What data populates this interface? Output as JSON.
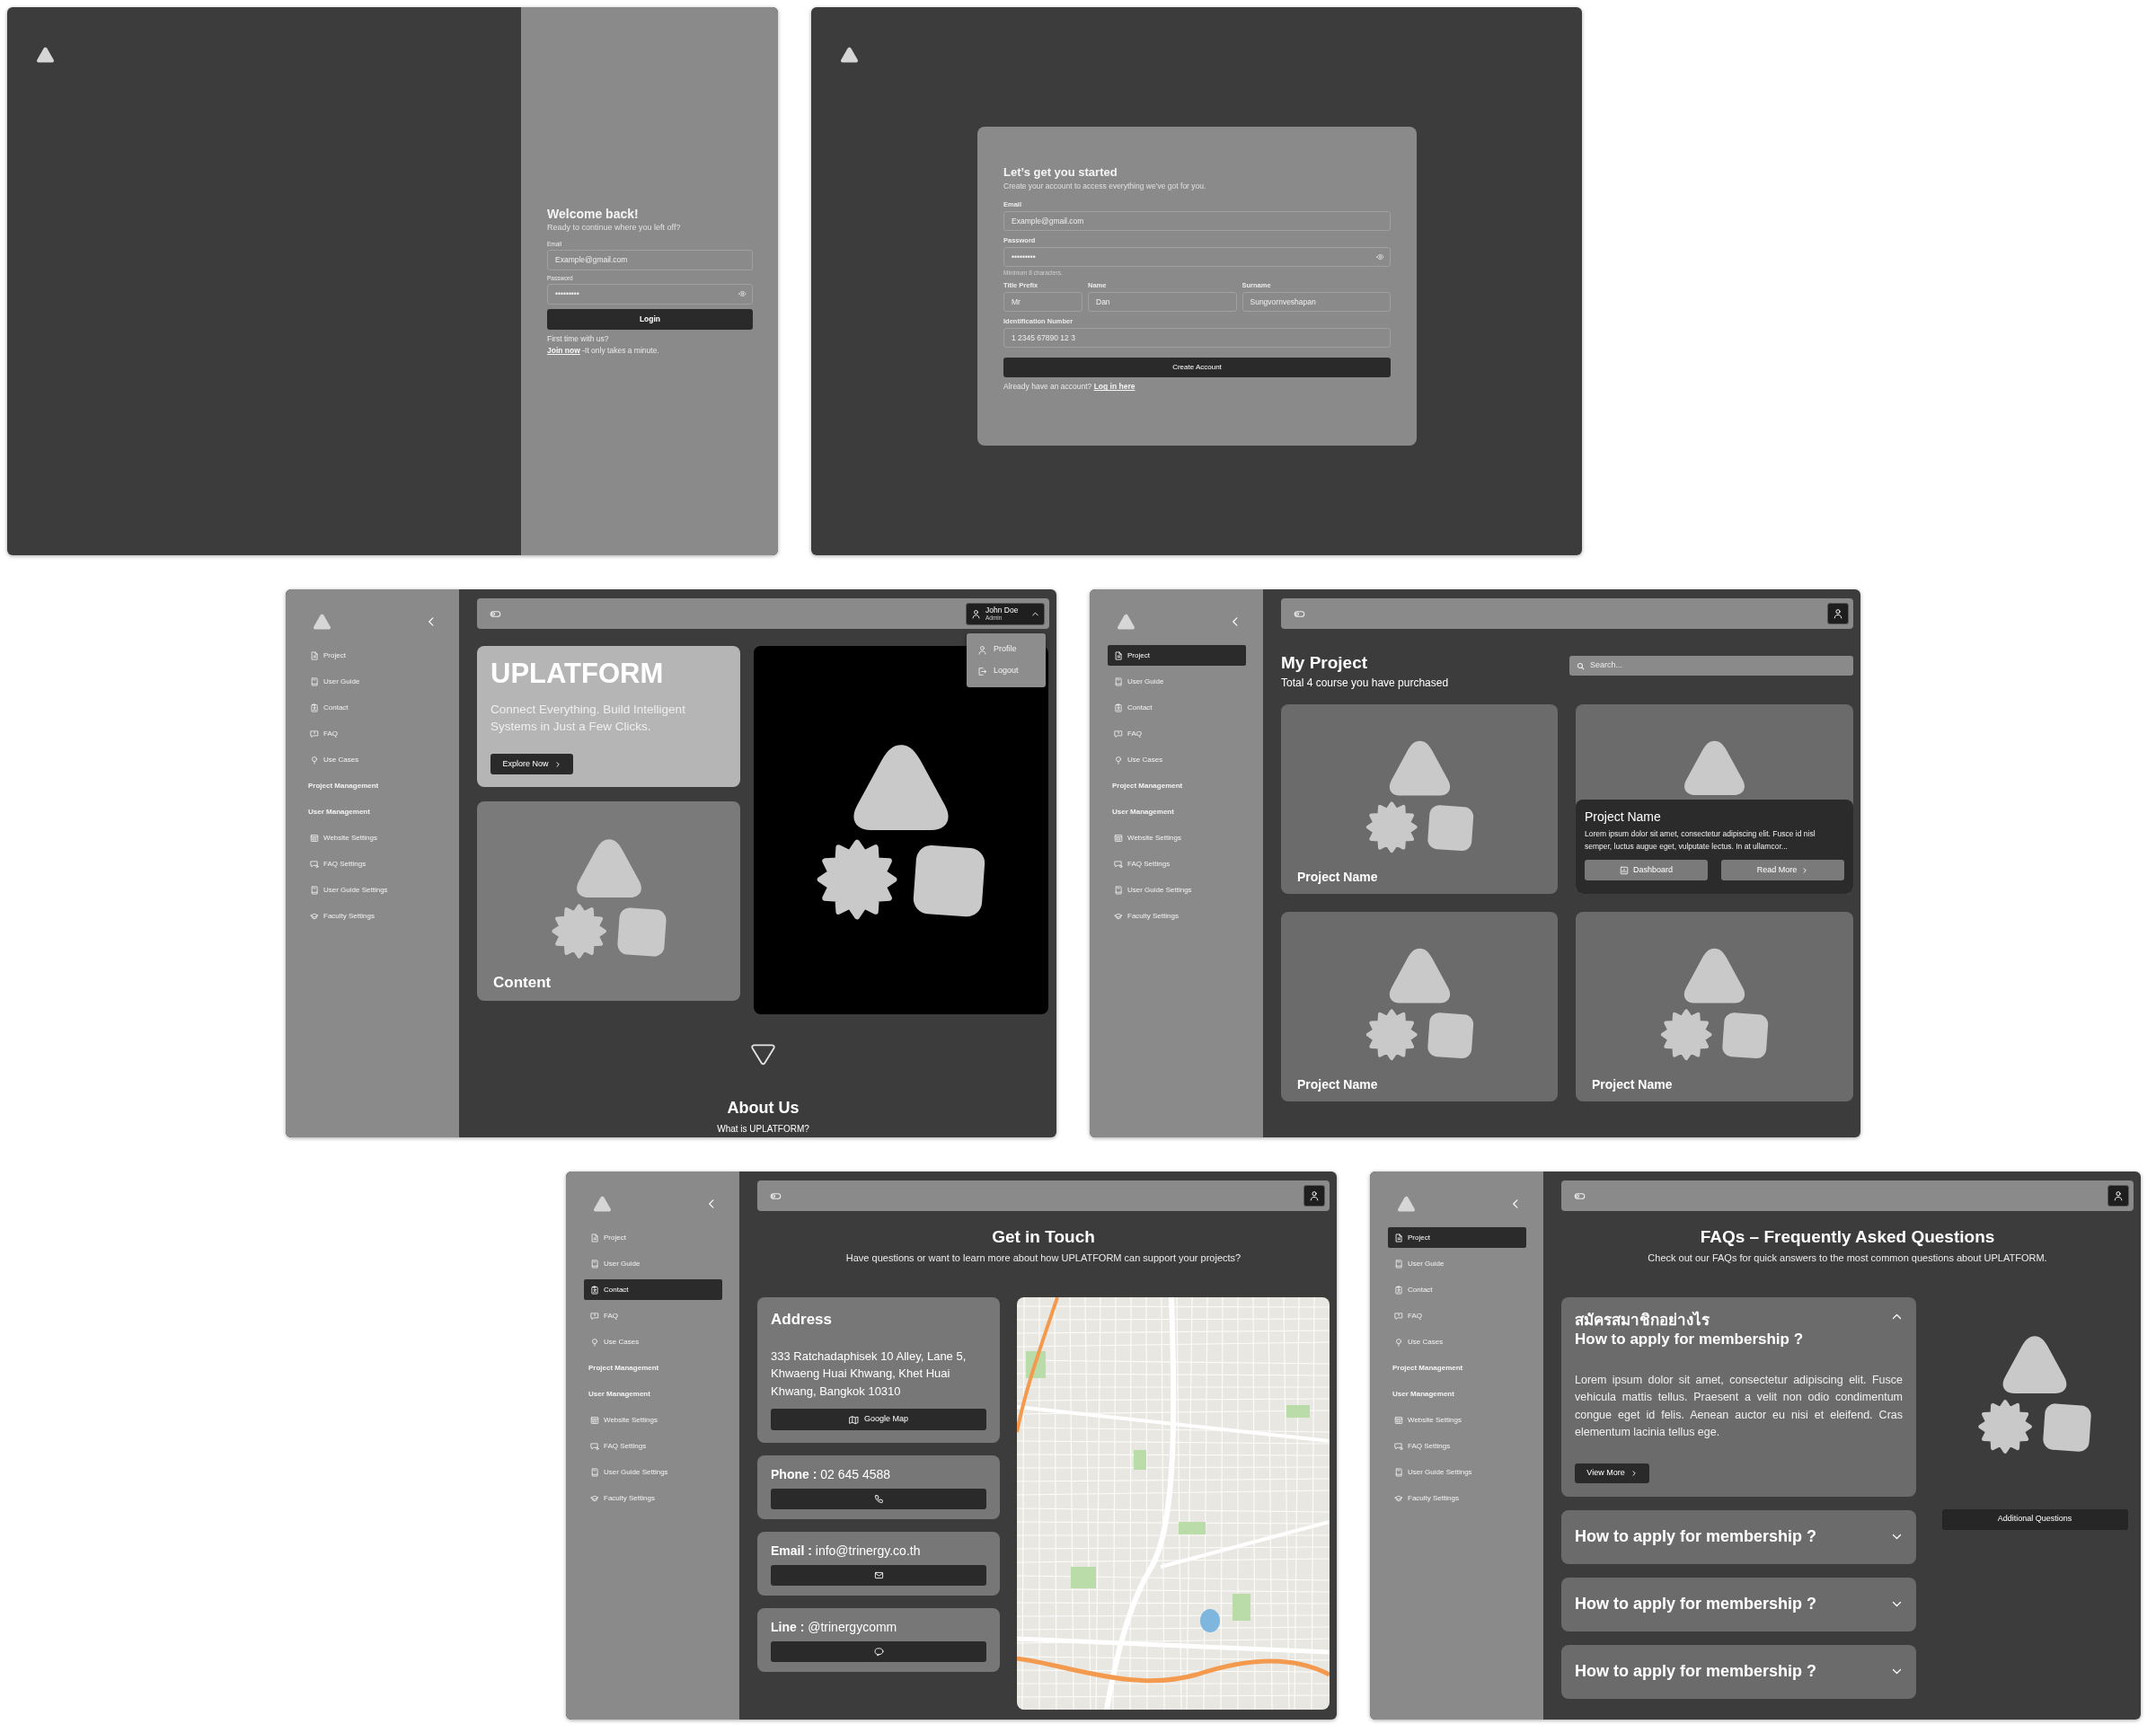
{
  "login": {
    "title": "Welcome back!",
    "subtitle": "Ready to continue where you left off?",
    "fields": [
      {
        "label": "Email",
        "value": "Example@gmail.com",
        "kind": "text"
      },
      {
        "label": "Password",
        "value": "•••••••••",
        "kind": "password"
      }
    ],
    "button": "Login",
    "note": "First time with us?",
    "footer": {
      "link": "Join now",
      "text": " -It only takes a minute."
    }
  },
  "signup": {
    "title": "Let’s get you started",
    "subtitle": "Create your account to access everything we’ve got for you.",
    "rows": [
      {
        "fields": [
          {
            "label": "Email",
            "value": "Example@gmail.com",
            "kind": "text"
          }
        ]
      },
      {
        "fields": [
          {
            "label": "Password",
            "value": "•••••••••",
            "kind": "password",
            "hint": "Minimum 8 characters."
          }
        ]
      },
      {
        "fields": [
          {
            "label": "Title Prefix",
            "value": "Mr",
            "kind": "text"
          },
          {
            "label": "Name",
            "value": "Dan",
            "kind": "text"
          },
          {
            "label": "Surname",
            "value": "Sungvornveshapan",
            "kind": "text"
          }
        ]
      },
      {
        "fields": [
          {
            "label": "Identification Number",
            "value": "1 2345 67890 12 3",
            "kind": "text"
          }
        ]
      }
    ],
    "button": "Create Account",
    "footer": {
      "text": "Already have an account? ",
      "link": "Log in here"
    }
  },
  "home": {
    "sidebar": {
      "items": [
        {
          "label": "Project",
          "kind": "link",
          "selected": false
        },
        {
          "label": "User Guide",
          "kind": "link",
          "selected": false
        },
        {
          "label": "Contact",
          "kind": "link",
          "selected": false
        },
        {
          "label": "FAQ",
          "kind": "link",
          "selected": false
        },
        {
          "label": "Use Cases",
          "kind": "link",
          "selected": false
        },
        {
          "label": "Project Management",
          "kind": "heading",
          "selected": false
        },
        {
          "label": "User Management",
          "kind": "heading",
          "selected": false
        },
        {
          "label": "Website Settings",
          "kind": "link",
          "selected": false
        },
        {
          "label": "FAQ Settings",
          "kind": "link",
          "selected": false
        },
        {
          "label": "User Guide Settings",
          "kind": "link",
          "selected": false
        },
        {
          "label": "Faculty Settings",
          "kind": "link",
          "selected": false
        }
      ]
    },
    "topbar": {
      "user": {
        "name": "John Doe",
        "role": "Admin",
        "expanded": true,
        "menu": [
          "Profile",
          "Logout"
        ]
      }
    },
    "hero": {
      "title": "UPLATFORM",
      "text": "Connect Everything. Build Intelligent Systems in Just a Few Clicks.",
      "button": "Explore Now"
    },
    "content_card": {
      "title": "Content"
    },
    "about": {
      "title": "About Us",
      "subtitle": "What is UPLATFORM?"
    }
  },
  "projects": {
    "sidebar": {
      "items": [
        {
          "label": "Project",
          "kind": "link",
          "selected": true
        },
        {
          "label": "User Guide",
          "kind": "link",
          "selected": false
        },
        {
          "label": "Contact",
          "kind": "link",
          "selected": false
        },
        {
          "label": "FAQ",
          "kind": "link",
          "selected": false
        },
        {
          "label": "Use Cases",
          "kind": "link",
          "selected": false
        },
        {
          "label": "Project Management",
          "kind": "heading",
          "selected": false
        },
        {
          "label": "User Management",
          "kind": "heading",
          "selected": false
        },
        {
          "label": "Website Settings",
          "kind": "link",
          "selected": false
        },
        {
          "label": "FAQ Settings",
          "kind": "link",
          "selected": false
        },
        {
          "label": "User Guide Settings",
          "kind": "link",
          "selected": false
        },
        {
          "label": "Faculty Settings",
          "kind": "link",
          "selected": false
        }
      ]
    },
    "title": "My Project",
    "subtitle": "Total 4 course you have purchased",
    "search": {
      "placeholder": "Search..."
    },
    "cards": [
      {
        "title": "Project Name",
        "expanded": false
      },
      {
        "title": "Project Name",
        "expanded": true,
        "description": "Lorem ipsum dolor sit amet, consectetur adipiscing elit. Fusce id nisl semper, luctus augue eget, vulputate lectus. In at ullamcor...",
        "buttons": [
          "Dashboard",
          "Read More"
        ]
      },
      {
        "title": "Project Name",
        "expanded": false
      },
      {
        "title": "Project Name",
        "expanded": false
      }
    ]
  },
  "contact": {
    "sidebar": {
      "items": [
        {
          "label": "Project",
          "kind": "link",
          "selected": false
        },
        {
          "label": "User Guide",
          "kind": "link",
          "selected": false
        },
        {
          "label": "Contact",
          "kind": "link",
          "selected": true
        },
        {
          "label": "FAQ",
          "kind": "link",
          "selected": false
        },
        {
          "label": "Use Cases",
          "kind": "link",
          "selected": false
        },
        {
          "label": "Project Management",
          "kind": "heading",
          "selected": false
        },
        {
          "label": "User Management",
          "kind": "heading",
          "selected": false
        },
        {
          "label": "Website Settings",
          "kind": "link",
          "selected": false
        },
        {
          "label": "FAQ Settings",
          "kind": "link",
          "selected": false
        },
        {
          "label": "User Guide Settings",
          "kind": "link",
          "selected": false
        },
        {
          "label": "Faculty Settings",
          "kind": "link",
          "selected": false
        }
      ]
    },
    "title": "Get in Touch",
    "subtitle": "Have questions or want to learn more about how UPLATFORM can support your projects?",
    "cards": [
      {
        "kind": "address",
        "title": "Address",
        "text": "333 Ratchadaphisek 10 Alley, Lane 5, Khwaeng Huai Khwang, Khet Huai Khwang, Bangkok 10310",
        "button": "Google Map"
      },
      {
        "kind": "phone",
        "text": "**Phone :** 02 645 4588"
      },
      {
        "kind": "email",
        "text": "**Email :** info@trinergy.co.th"
      },
      {
        "kind": "line",
        "text": "**Line :** @trinergycomm"
      }
    ]
  },
  "faq": {
    "sidebar": {
      "items": [
        {
          "label": "Project",
          "kind": "link",
          "selected": true
        },
        {
          "label": "User Guide",
          "kind": "link",
          "selected": false
        },
        {
          "label": "Contact",
          "kind": "link",
          "selected": false
        },
        {
          "label": "FAQ",
          "kind": "link",
          "selected": false
        },
        {
          "label": "Use Cases",
          "kind": "link",
          "selected": false
        },
        {
          "label": "Project Management",
          "kind": "heading",
          "selected": false
        },
        {
          "label": "User Management",
          "kind": "heading",
          "selected": false
        },
        {
          "label": "Website Settings",
          "kind": "link",
          "selected": false
        },
        {
          "label": "FAQ Settings",
          "kind": "link",
          "selected": false
        },
        {
          "label": "User Guide Settings",
          "kind": "link",
          "selected": false
        },
        {
          "label": "Faculty Settings",
          "kind": "link",
          "selected": false
        }
      ]
    },
    "title": "FAQs – Frequently Asked Questions",
    "subtitle": "Check out our FAQs for quick answers to the most common questions about UPLATFORM.",
    "items": [
      {
        "thai_title": "สมัครสมาชิกอย่างไร",
        "title": "How to apply for membership ?",
        "expanded": true,
        "answer": "Lorem ipsum dolor sit amet, consectetur adipiscing elit. Fusce vehicula mattis tellus. Praesent a velit non odio condimentum congue eget id felis. Aenean auctor eu nisi et eleifend. Cras elementum lacinia tellus ege.",
        "button": "View More"
      },
      {
        "title": "How to apply for membership ?",
        "expanded": false
      },
      {
        "title": "How to apply for membership ?",
        "expanded": false
      },
      {
        "title": "How to apply for membership ?",
        "expanded": false
      }
    ],
    "side_button": "Additional Questions"
  }
}
